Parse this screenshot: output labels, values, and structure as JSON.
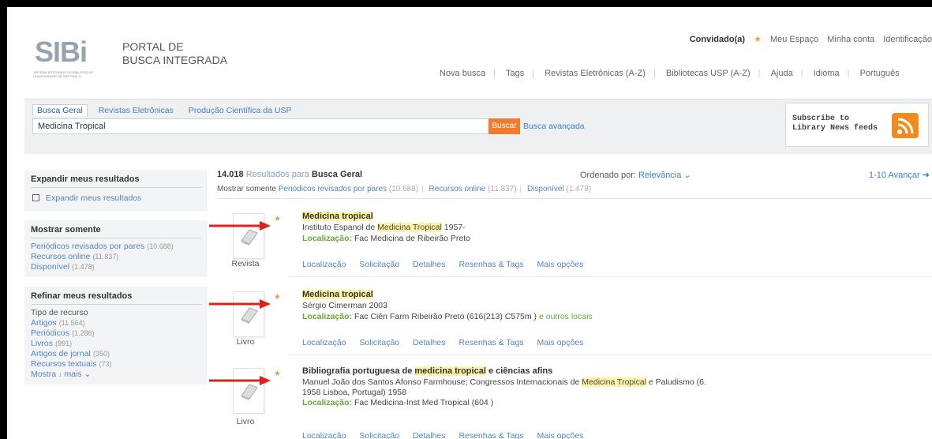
{
  "header": {
    "logo_text": "SIBi",
    "logo_sub": "SISTEMA INTEGRADO DE BIBLIOTECAS UNIVERSIDADE DE SÃO PAULO",
    "portal_line1": "PORTAL DE",
    "portal_line2": "BUSCA INTEGRADA",
    "guest": "Convidado(a)",
    "my_space": "Meu Espaço",
    "my_account": "Minha conta",
    "login": "Identificação"
  },
  "topnav": [
    "Nova busca",
    "Tags",
    "Revistas Eletrônicas (A-Z)",
    "Bibliotecas USP (A-Z)",
    "Ajuda",
    "Idioma",
    "Português"
  ],
  "search": {
    "tabs": [
      "Busca Geral",
      "Revistas Eletrônicas",
      "Produção Científica da USP"
    ],
    "query": "Medicina Tropical",
    "button": "Buscar",
    "advanced": "Busca avançada",
    "rss": "Subscribe to Library News feeds"
  },
  "sidebar": {
    "expand_title": "Expandir meus resultados",
    "expand_option": "Expandir meus resultados",
    "show_title": "Mostrar somente",
    "show_items": [
      {
        "label": "Periódicos revisados por pares",
        "count": "(10.688)"
      },
      {
        "label": "Recursos online",
        "count": "(11.837)"
      },
      {
        "label": "Disponível",
        "count": "(1.478)"
      }
    ],
    "refine_title": "Refinar meus resultados",
    "resource_type": "Tipo de recurso",
    "refine_items": [
      {
        "label": "Artigos",
        "count": "(11.564)"
      },
      {
        "label": "Periódicos",
        "count": "(1.286)"
      },
      {
        "label": "Livros",
        "count": "(991)"
      },
      {
        "label": "Artigos de jornal",
        "count": "(350)"
      },
      {
        "label": "Recursos textuais",
        "count": "(73)"
      }
    ],
    "more": "Mostra",
    "more2": "mais"
  },
  "results": {
    "count": "14.018",
    "results_for": "Resultados para",
    "scope": "Busca Geral",
    "sort_label": "Ordenado por:",
    "sort_value": "Relevância",
    "pager": "1-10 Avançar",
    "show_only": "Mostrar somente",
    "filters": [
      {
        "label": "Periódicos revisados por pares",
        "count": "(10.688)"
      },
      {
        "label": "Recursos online",
        "count": "(11.837)"
      },
      {
        "label": "Disponível",
        "count": "(1.478)"
      }
    ],
    "location_label": "Localização:",
    "actions": [
      "Localização",
      "Solicitação",
      "Detalhes",
      "Resenhas & Tags",
      "Mais opções"
    ],
    "records": [
      {
        "type": "Revista",
        "title_pre": "Medicina tropical",
        "title_hl": "",
        "title_post": "",
        "line1_pre": "Instituto Espanol de ",
        "line1_hl": "Medicina Tropical",
        "line1_post": " 1957-",
        "line2": "",
        "location": "Fac Medicina de Ribeirão Preto",
        "location_extra": ""
      },
      {
        "type": "Livro",
        "title_pre": "Medicina tropical",
        "title_hl": "",
        "title_post": "",
        "line1_pre": "Sérgio Cimerman 2003",
        "line1_hl": "",
        "line1_post": "",
        "line2": "",
        "location": "Fac Ciên Farm Ribeirão Preto  (616(213) C575m )",
        "location_extra": "e outros locais"
      },
      {
        "type": "Livro",
        "title_pre": "Bibliografia portuguesa de ",
        "title_hl": "medicina tropical",
        "title_post": " e ciências afins",
        "line1_pre": "Manuel João dos Santos Afonso Farmhouse; Congressos Internacionais de ",
        "line1_hl": "Medicina Tropical",
        "line1_post": " e Paludismo (6.",
        "line2": "1958 Lisboa, Portugal) 1958",
        "location": "Fac Medicina-Inst Med Tropical  (604 )",
        "location_extra": ""
      }
    ]
  },
  "colors": {
    "accent_orange": "#f07b2e",
    "link_blue": "#3b7fc4",
    "location_green": "#6aa63a",
    "highlight": "#fff5a8",
    "arrow_red": "#e0201a"
  }
}
